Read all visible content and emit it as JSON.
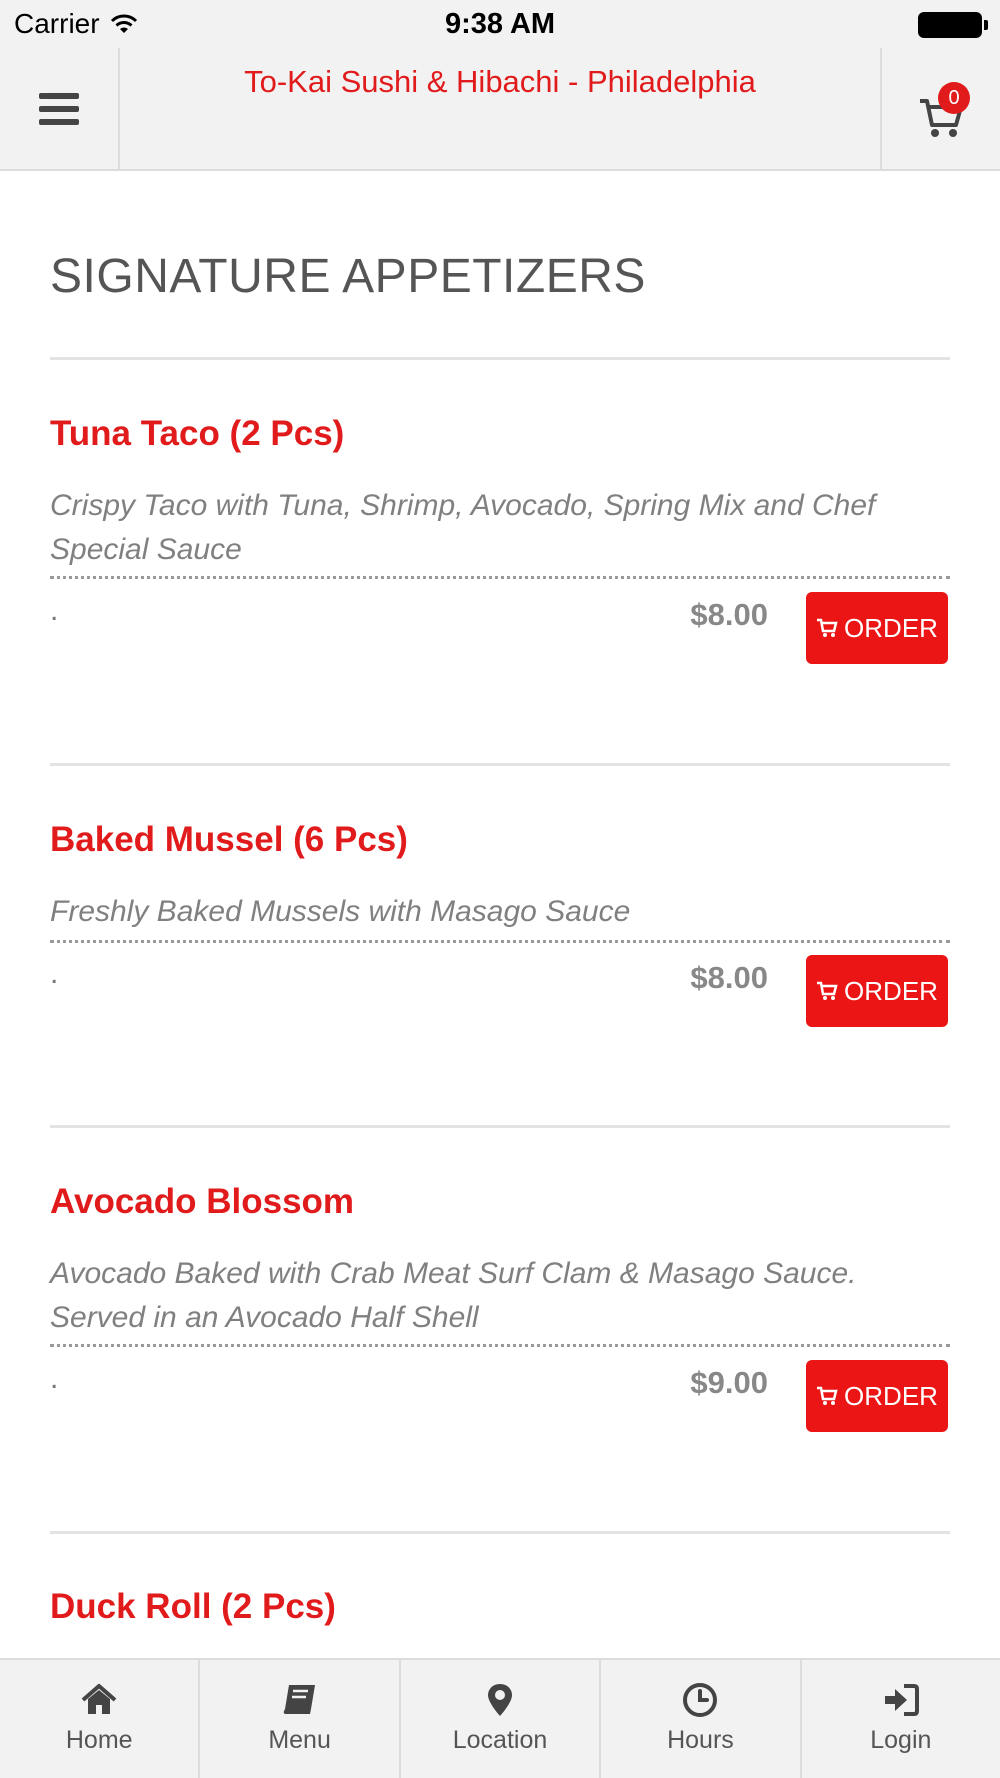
{
  "status_bar": {
    "carrier": "Carrier",
    "time": "9:38 AM"
  },
  "header": {
    "title": "To-Kai Sushi & Hibachi - Philadelphia",
    "cart_count": "0"
  },
  "section": {
    "title": "SIGNATURE APPETIZERS"
  },
  "items": [
    {
      "name": "Tuna Taco (2 Pcs)",
      "description": "Crispy Taco with Tuna, Shrimp, Avocado, Spring Mix and Chef Special Sauce",
      "mark": ".",
      "price": "$8.00",
      "order_label": "ORDER"
    },
    {
      "name": "Baked Mussel (6 Pcs)",
      "description": "Freshly Baked Mussels with Masago Sauce",
      "mark": ".",
      "price": "$8.00",
      "order_label": "ORDER"
    },
    {
      "name": "Avocado Blossom",
      "description": "Avocado Baked with Crab Meat Surf Clam & Masago Sauce. Served in an Avocado Half Shell",
      "mark": ".",
      "price": "$9.00",
      "order_label": "ORDER"
    },
    {
      "name": "Duck Roll (2 Pcs)"
    }
  ],
  "bottom_nav": [
    {
      "label": "Home",
      "icon": "home-icon"
    },
    {
      "label": "Menu",
      "icon": "book-icon"
    },
    {
      "label": "Location",
      "icon": "map-pin-icon"
    },
    {
      "label": "Hours",
      "icon": "clock-icon"
    },
    {
      "label": "Login",
      "icon": "sign-in-icon"
    }
  ],
  "colors": {
    "accent": "#e11b1b",
    "button": "#ec1515",
    "bar": "#f2f2f2"
  }
}
